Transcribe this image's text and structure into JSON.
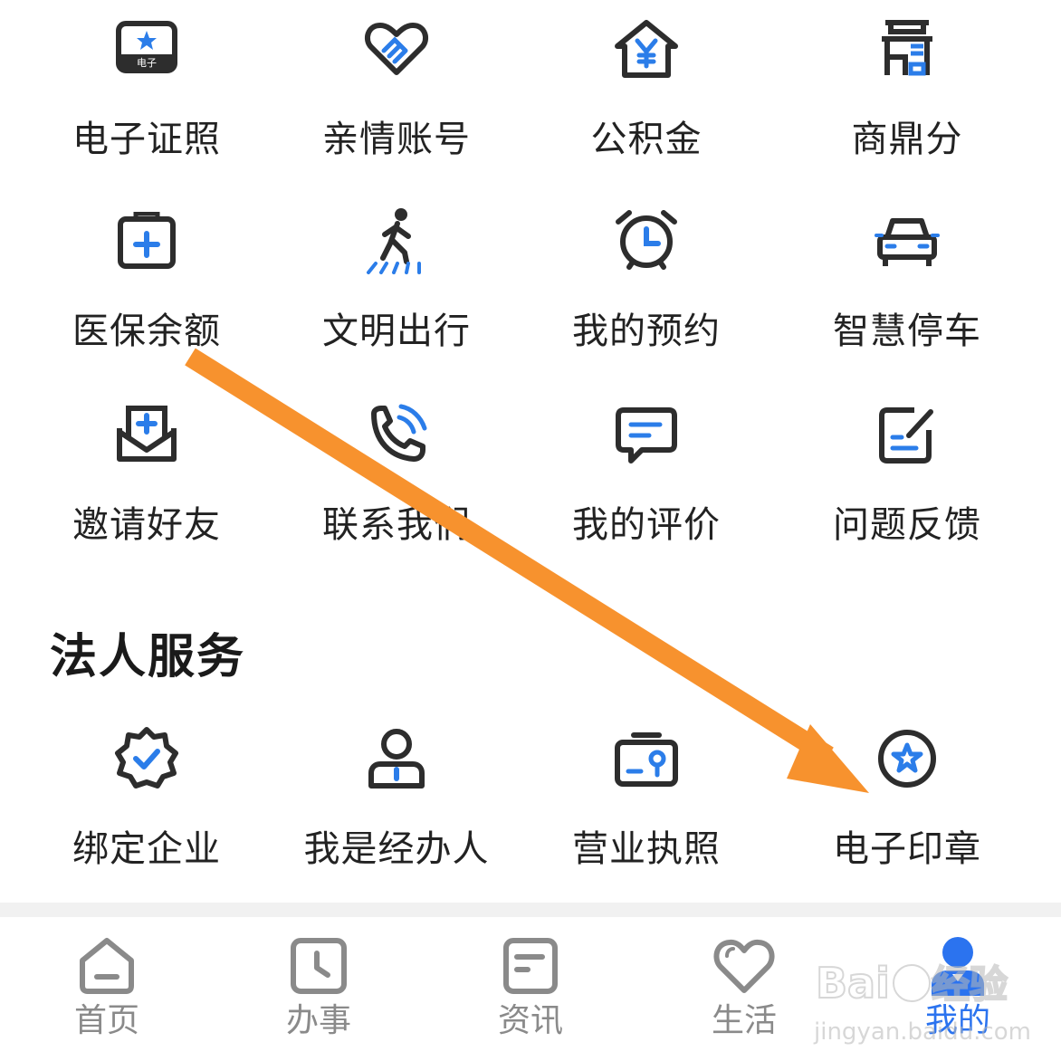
{
  "personal_services": [
    {
      "label": "电子证照",
      "icon": "e-certificate-icon"
    },
    {
      "label": "亲情账号",
      "icon": "handshake-heart-icon"
    },
    {
      "label": "公积金",
      "icon": "yuan-house-icon"
    },
    {
      "label": "商鼎分",
      "icon": "shangding-tower-icon"
    },
    {
      "label": "医保余额",
      "icon": "medical-kit-icon"
    },
    {
      "label": "文明出行",
      "icon": "pedestrian-crosswalk-icon"
    },
    {
      "label": "我的预约",
      "icon": "alarm-clock-icon"
    },
    {
      "label": "智慧停车",
      "icon": "car-icon"
    },
    {
      "label": "邀请好友",
      "icon": "invite-envelope-icon"
    },
    {
      "label": "联系我们",
      "icon": "phone-call-icon"
    },
    {
      "label": "我的评价",
      "icon": "comment-bubble-icon"
    },
    {
      "label": "问题反馈",
      "icon": "feedback-edit-icon"
    }
  ],
  "legal_section": {
    "title": "法人服务",
    "items": [
      {
        "label": "绑定企业",
        "icon": "verified-badge-icon"
      },
      {
        "label": "我是经办人",
        "icon": "agent-person-icon"
      },
      {
        "label": "营业执照",
        "icon": "business-license-icon"
      },
      {
        "label": "电子印章",
        "icon": "e-seal-star-icon"
      }
    ]
  },
  "tabbar": {
    "tabs": [
      {
        "label": "首页",
        "icon": "home-icon",
        "active": false
      },
      {
        "label": "办事",
        "icon": "clock-square-icon",
        "active": false
      },
      {
        "label": "资讯",
        "icon": "news-icon",
        "active": false
      },
      {
        "label": "生活",
        "icon": "heart-icon",
        "active": false
      },
      {
        "label": "我的",
        "icon": "user-profile-icon",
        "active": true
      }
    ]
  },
  "watermark": {
    "brand": "Baidu经验",
    "url": "jingyan.baidu.com"
  },
  "colors": {
    "icon_dark": "#2d2d2d",
    "icon_accent": "#2b7de9",
    "tab_inactive": "#8a8a8a",
    "tab_active": "#2b73ef",
    "annotation_arrow": "#f7922e"
  }
}
